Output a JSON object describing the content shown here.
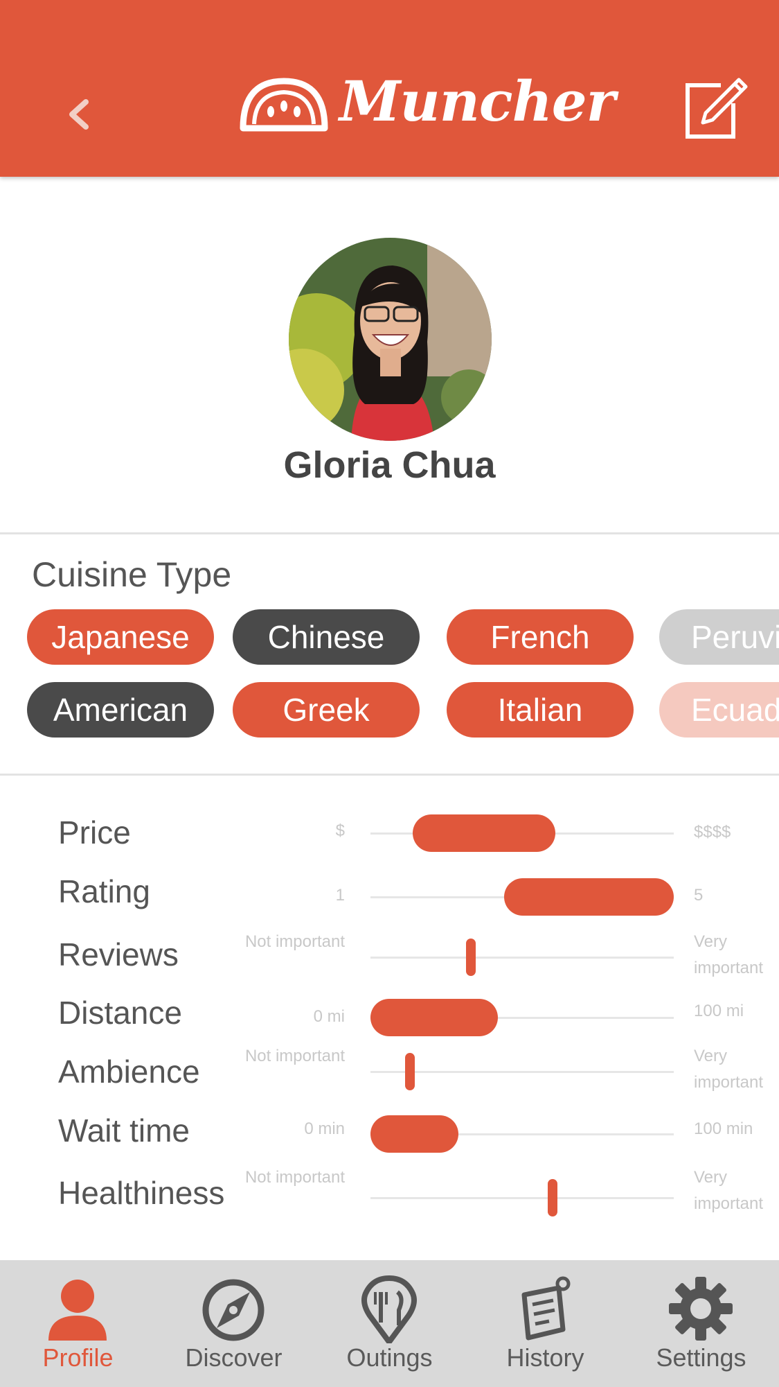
{
  "header": {
    "app_name": "Muncher",
    "back_icon": "chevron-left-icon",
    "edit_icon": "edit-icon",
    "logo_icon": "melon-logo-icon",
    "background_color": "#E0573B"
  },
  "profile": {
    "name": "Gloria Chua",
    "avatar": "avatar-photo"
  },
  "cuisine": {
    "title": "Cuisine Type",
    "chips": [
      {
        "label": "Japanese",
        "state": "selected"
      },
      {
        "label": "Chinese",
        "state": "excluded"
      },
      {
        "label": "French",
        "state": "selected"
      },
      {
        "label": "Peruvian",
        "state": "disabled"
      },
      {
        "label": "American",
        "state": "excluded"
      },
      {
        "label": "Greek",
        "state": "selected"
      },
      {
        "label": "Italian",
        "state": "selected"
      },
      {
        "label": "Ecuadorian",
        "state": "faded"
      }
    ]
  },
  "preferences": [
    {
      "label": "Price",
      "min": "$",
      "max": "$$$$",
      "type": "range",
      "from": 0.14,
      "to": 0.61
    },
    {
      "label": "Rating",
      "min": "1",
      "max": "5",
      "type": "range",
      "from": 0.44,
      "to": 1.0
    },
    {
      "label": "Reviews",
      "min": "Not important",
      "max": "Very important",
      "type": "point",
      "value": 0.33
    },
    {
      "label": "Distance",
      "min": "0 mi",
      "max": "100 mi",
      "type": "range",
      "from": 0.0,
      "to": 0.42
    },
    {
      "label": "Ambience",
      "min": "Not important",
      "max": "Very important",
      "type": "point",
      "value": 0.13
    },
    {
      "label": "Wait time",
      "min": "0 min",
      "max": "100 min",
      "type": "range",
      "from": 0.0,
      "to": 0.29
    },
    {
      "label": "Healthiness",
      "min": "Not important",
      "max": "Very important",
      "type": "point",
      "value": 0.6
    }
  ],
  "tabs": [
    {
      "label": "Profile",
      "icon": "user-icon",
      "active": true
    },
    {
      "label": "Discover",
      "icon": "compass-icon",
      "active": false
    },
    {
      "label": "Outings",
      "icon": "fork-pin-icon",
      "active": false
    },
    {
      "label": "History",
      "icon": "receipt-icon",
      "active": false
    },
    {
      "label": "Settings",
      "icon": "gear-icon",
      "active": false
    }
  ],
  "colors": {
    "accent": "#E0573B",
    "dark_chip": "#4a4a4a",
    "disabled_chip": "#cfcfcf",
    "faded_chip": "#f5c9bf",
    "tabbar": "#d9d9d9"
  }
}
